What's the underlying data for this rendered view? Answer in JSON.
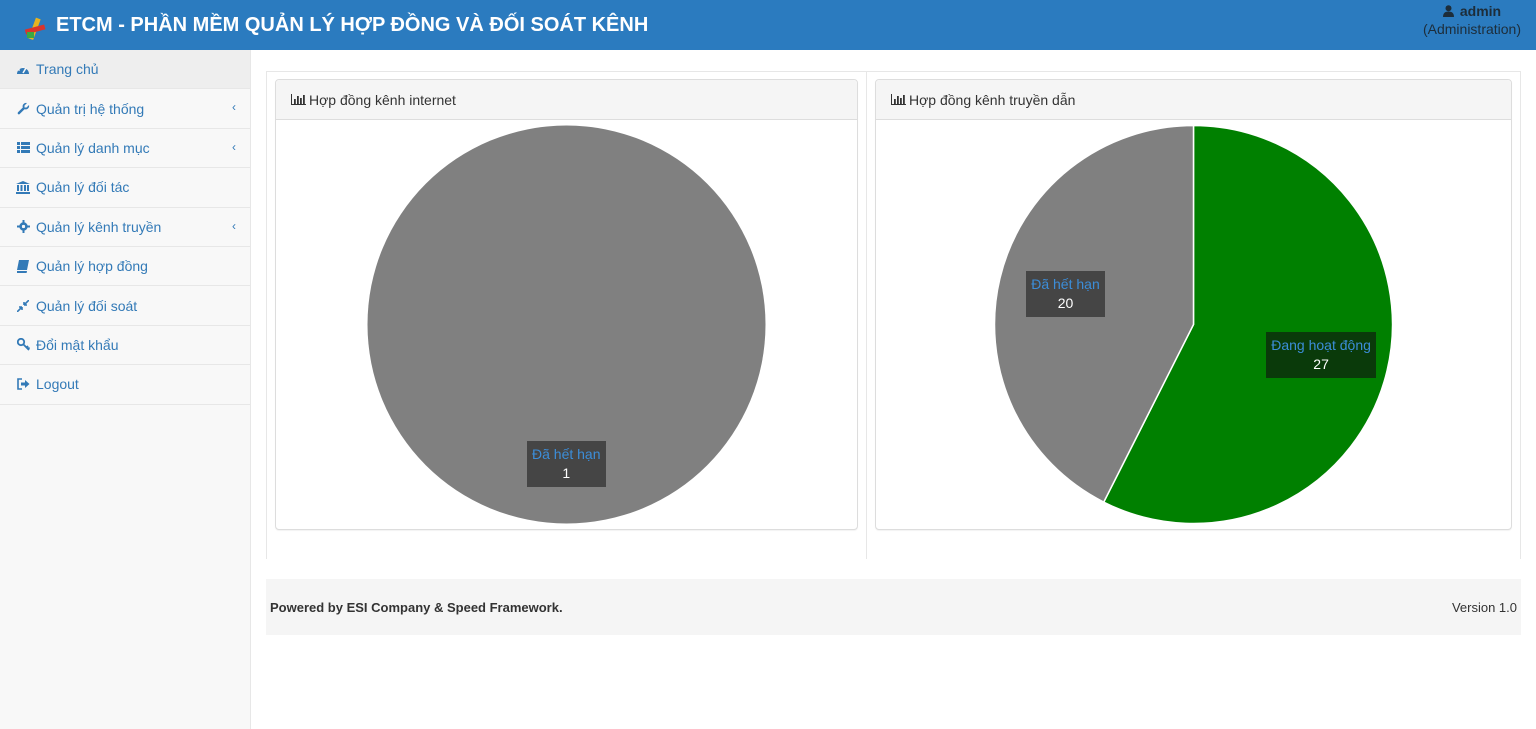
{
  "header": {
    "title": "ETCM - PHẦN MỀM QUẢN LÝ HỢP ĐỒNG VÀ ĐỐI SOÁT KÊNH",
    "user_name": "admin",
    "user_role": "(Administration)",
    "bg_color": "#2b7bbf"
  },
  "sidebar": {
    "items": [
      {
        "label": "Trang chủ",
        "icon": "dashboard-icon",
        "submenu": false
      },
      {
        "label": "Quản trị hệ thống",
        "icon": "wrench-icon",
        "submenu": true
      },
      {
        "label": "Quản lý danh mục",
        "icon": "list-icon",
        "submenu": true
      },
      {
        "label": "Quản lý đối tác",
        "icon": "bank-icon",
        "submenu": false
      },
      {
        "label": "Quản lý kênh truyền",
        "icon": "gear-icon",
        "submenu": true
      },
      {
        "label": "Quản lý hợp đồng",
        "icon": "book-icon",
        "submenu": false
      },
      {
        "label": "Quản lý đối soát",
        "icon": "compress-icon",
        "submenu": false
      },
      {
        "label": "Đổi mật khẩu",
        "icon": "key-icon",
        "submenu": false
      },
      {
        "label": "Logout",
        "icon": "sign-out-icon",
        "submenu": false
      }
    ],
    "chevron": "‹"
  },
  "panels": [
    {
      "title": "Hợp đồng kênh internet",
      "icon": "bar-chart-icon"
    },
    {
      "title": "Hợp đồng kênh truyền dẫn",
      "icon": "bar-chart-icon"
    }
  ],
  "chart_data": [
    {
      "type": "pie",
      "title": "Hợp đồng kênh internet",
      "slices": [
        {
          "label": "Đã hết hạn",
          "value": 1,
          "color": "#808080"
        }
      ]
    },
    {
      "type": "pie",
      "title": "Hợp đồng kênh truyền dẫn",
      "slices": [
        {
          "label": "Đang hoạt động",
          "value": 27,
          "color": "#008000"
        },
        {
          "label": "Đã hết hạn",
          "value": 20,
          "color": "#808080"
        }
      ]
    }
  ],
  "footer": {
    "left": "Powered by ESI Company & Speed Framework.",
    "right": "Version 1.0"
  }
}
